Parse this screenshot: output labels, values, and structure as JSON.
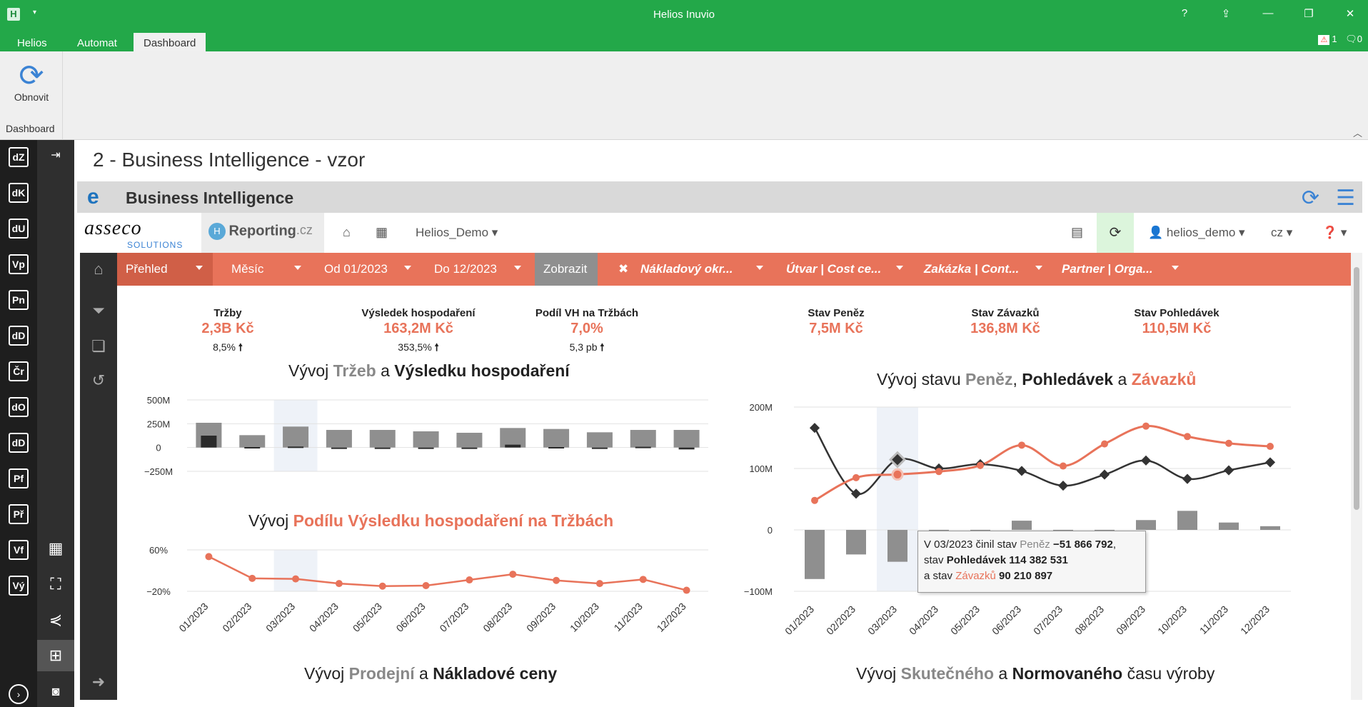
{
  "window": {
    "title": "Helios Inuvio",
    "qa_icon": "▾",
    "help": "?",
    "alerts_count": "1",
    "messages_count": "0"
  },
  "tabs": [
    {
      "label": "Helios"
    },
    {
      "label": "Automat"
    },
    {
      "label": "Dashboard"
    }
  ],
  "ribbon": {
    "refresh_label": "Obnovit",
    "group_label": "Dashboard"
  },
  "leftbar": [
    "dZ",
    "dK",
    "dU",
    "Vp",
    "Pn",
    "dD",
    "Čr",
    "dO",
    "dD",
    "Pf",
    "Př",
    "Vf",
    "Vý"
  ],
  "page": {
    "title": "2 - Business Intelligence - vzor"
  },
  "bi": {
    "header": "Business Intelligence"
  },
  "nav": {
    "asseco": "asseco",
    "solutions": "SOLUTIONS",
    "reporting": "Reporting",
    "reporting_tld": ".cz",
    "hex_icon": "H",
    "demo": "Helios_Demo",
    "user": "helios_demo",
    "lang": "cz"
  },
  "filters": {
    "prehled": "Přehled",
    "mesic": "Měsíc",
    "od": "Od 01/2023",
    "do": "Do 12/2023",
    "zobrazit": "Zobrazit",
    "clear": "✖",
    "nakladovy": "Nákladový okr...",
    "utvar": "Útvar | Cost ce...",
    "zakazka": "Zakázka | Cont...",
    "partner": "Partner | Orga..."
  },
  "kpis": [
    {
      "label": "Tržby",
      "value": "2,3B Kč",
      "delta": "8,5%",
      "arrow": "🠕"
    },
    {
      "label": "Výsledek hospodaření",
      "value": "163,2M Kč",
      "delta": "353,5%",
      "arrow": "🠕"
    },
    {
      "label": "Podíl VH na Tržbách",
      "value": "7,0%",
      "delta": "5,3 pb",
      "arrow": "🠕"
    },
    {
      "label": "Stav Peněz",
      "value": "7,5M Kč"
    },
    {
      "label": "Stav Závazků",
      "value": "136,8M Kč"
    },
    {
      "label": "Stav Pohledávek",
      "value": "110,5M Kč"
    }
  ],
  "titles": {
    "t1a": "Vývoj ",
    "t1b": "Tržeb",
    "t1c": " a ",
    "t1d": "Výsledku hospodaření",
    "t2a": "Vývoj ",
    "t2b": "Podílu Výsledku hospodaření na Tržbách",
    "t3a": "Vývoj stavu ",
    "t3b": "Peněz",
    "t3c": ", ",
    "t3d": "Pohledávek",
    "t3e": " a ",
    "t3f": "Závazků",
    "t4a": "Vývoj ",
    "t4b": "Prodejní",
    "t4c": " a ",
    "t4d": "Nákladové ceny",
    "t5a": "Vývoj ",
    "t5b": "Skutečného",
    "t5c": " a ",
    "t5d": "Normovaného",
    "t5e": " času výroby"
  },
  "tooltip": {
    "l1a": "V 03/2023 činil stav ",
    "l1b": "Peněz",
    "l1c": " −51 866 792",
    "l1d": ",",
    "l2a": "stav ",
    "l2b": "Pohledávek",
    "l2c": " 114 382 531",
    "l3a": "a stav ",
    "l3b": "Závazků",
    "l3c": " 90 210 897"
  },
  "colors": {
    "accent": "#e8735a",
    "gray": "#8f8f8f",
    "dark": "#333333",
    "green": "#23a849"
  },
  "chart_data": [
    {
      "type": "bar",
      "categories": [
        "01/2023",
        "02/2023",
        "03/2023",
        "04/2023",
        "05/2023",
        "06/2023",
        "07/2023",
        "08/2023",
        "09/2023",
        "10/2023",
        "11/2023",
        "12/2023"
      ],
      "series": [
        {
          "name": "Tržeb",
          "values": [
            260,
            130,
            220,
            185,
            185,
            170,
            155,
            205,
            195,
            160,
            185,
            185
          ]
        },
        {
          "name": "Výsledku hospodaření",
          "values": [
            125,
            5,
            10,
            0,
            -10,
            -10,
            0,
            30,
            5,
            0,
            8,
            -20
          ]
        }
      ],
      "yticks": [
        "500M",
        "250M",
        "0",
        "−250M"
      ],
      "ylim": [
        -250,
        500
      ],
      "highlight": "03/2023"
    },
    {
      "type": "line",
      "categories": [
        "01/2023",
        "02/2023",
        "03/2023",
        "04/2023",
        "05/2023",
        "06/2023",
        "07/2023",
        "08/2023",
        "09/2023",
        "10/2023",
        "11/2023",
        "12/2023"
      ],
      "series": [
        {
          "name": "Podílu Výsledku hospodaření na Tržbách",
          "values": [
            47,
            5,
            4,
            -5,
            -10,
            -9,
            2,
            13,
            1,
            -5,
            3,
            -18
          ]
        }
      ],
      "yticks": [
        "60%",
        "−20%"
      ],
      "ylim": [
        -20,
        60
      ]
    },
    {
      "type": "line",
      "categories": [
        "01/2023",
        "02/2023",
        "03/2023",
        "04/2023",
        "05/2023",
        "06/2023",
        "07/2023",
        "08/2023",
        "09/2023",
        "10/2023",
        "11/2023",
        "12/2023"
      ],
      "series": [
        {
          "name": "Peněz",
          "type": "bar",
          "values": [
            -80,
            -40,
            -51.9,
            -15,
            -8,
            15,
            -12,
            -5,
            16,
            31,
            12,
            6
          ]
        },
        {
          "name": "Pohledávek",
          "values": [
            166,
            59,
            114.4,
            100,
            107,
            96,
            72,
            90,
            113,
            83,
            97,
            110
          ]
        },
        {
          "name": "Závazků",
          "values": [
            48,
            85,
            90.2,
            95,
            105,
            138,
            104,
            140,
            169,
            152,
            141,
            136
          ]
        }
      ],
      "yticks": [
        "200M",
        "100M",
        "0",
        "−100M"
      ],
      "ylim": [
        -100,
        200
      ],
      "highlight": "03/2023"
    }
  ]
}
